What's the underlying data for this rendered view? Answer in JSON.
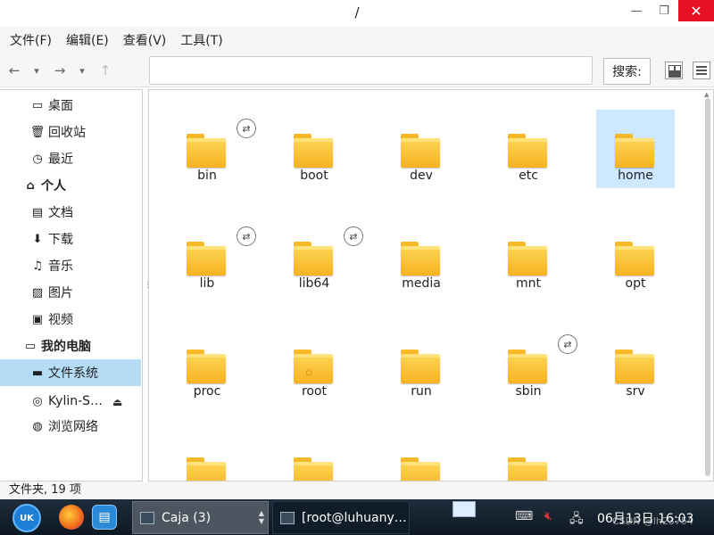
{
  "window": {
    "title": "/",
    "min_label": "—",
    "max_label": "❐",
    "close_label": "✕"
  },
  "menu": [
    {
      "label": "文件(F)"
    },
    {
      "label": "编辑(E)"
    },
    {
      "label": "查看(V)"
    },
    {
      "label": "工具(T)"
    }
  ],
  "toolbar": {
    "back_icon": "←",
    "back_dropdown": "▾",
    "forward_icon": "→",
    "forward_dropdown": "▾",
    "up_icon": "↑",
    "location_value": "",
    "search_label": "搜索:"
  },
  "sidebar": {
    "items": [
      {
        "label": "桌面",
        "icon": "desktop-icon",
        "glyph": "▭",
        "type": "child"
      },
      {
        "label": "回收站",
        "icon": "trash-icon",
        "glyph": "🗑",
        "type": "child"
      },
      {
        "label": "最近",
        "icon": "clock-icon",
        "glyph": "◷",
        "type": "child"
      },
      {
        "label": "个人",
        "icon": "home-icon",
        "glyph": "⌂",
        "type": "header"
      },
      {
        "label": "文档",
        "icon": "document-icon",
        "glyph": "▤",
        "type": "child"
      },
      {
        "label": "下载",
        "icon": "download-icon",
        "glyph": "⬇",
        "type": "child"
      },
      {
        "label": "音乐",
        "icon": "music-icon",
        "glyph": "♫",
        "type": "child"
      },
      {
        "label": "图片",
        "icon": "picture-icon",
        "glyph": "▨",
        "type": "child"
      },
      {
        "label": "视频",
        "icon": "video-icon",
        "glyph": "▣",
        "type": "child"
      },
      {
        "label": "我的电脑",
        "icon": "computer-icon",
        "glyph": "▭",
        "type": "header"
      },
      {
        "label": "文件系统",
        "icon": "drive-icon",
        "glyph": "▬",
        "type": "child",
        "selected": true
      },
      {
        "label": "Kylin-S…",
        "icon": "disc-icon",
        "glyph": "◎",
        "type": "child",
        "eject": true
      },
      {
        "label": "浏览网络",
        "icon": "network-icon",
        "glyph": "◍",
        "type": "child"
      }
    ],
    "eject_glyph": "⏏"
  },
  "files": [
    {
      "name": "bin",
      "link": true
    },
    {
      "name": "boot"
    },
    {
      "name": "dev"
    },
    {
      "name": "etc"
    },
    {
      "name": "home",
      "selected": true
    },
    {
      "name": "lib",
      "link": true
    },
    {
      "name": "lib64",
      "link": true
    },
    {
      "name": "media"
    },
    {
      "name": "mnt"
    },
    {
      "name": "opt"
    },
    {
      "name": "proc"
    },
    {
      "name": "root",
      "home_emblem": true
    },
    {
      "name": "run"
    },
    {
      "name": "sbin",
      "link": true
    },
    {
      "name": "srv"
    },
    {
      "name": ""
    },
    {
      "name": ""
    },
    {
      "name": ""
    },
    {
      "name": ""
    }
  ],
  "status": {
    "text": "文件夹, 19 项"
  },
  "taskbar": {
    "start_label": "UK",
    "tasks": [
      {
        "label": "Caja (3)"
      },
      {
        "label": "[root@luhuany…"
      }
    ],
    "clock": "06月13日 16:03"
  },
  "watermark": "CSDN @lh23754"
}
